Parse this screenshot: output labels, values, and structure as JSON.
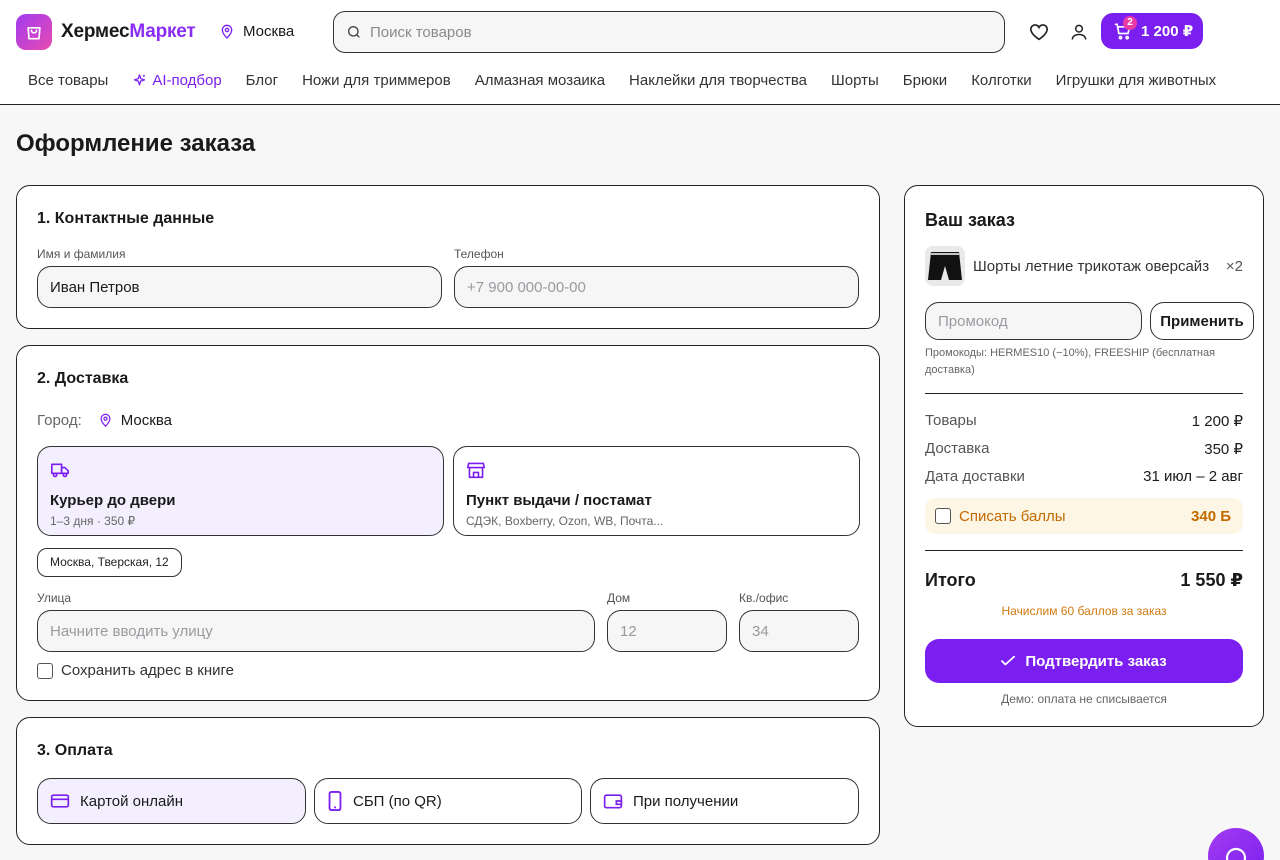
{
  "header": {
    "brand_part1": "Хермес",
    "brand_part2": "Маркет",
    "city": "Москва",
    "search_placeholder": "Поиск товаров",
    "cart_count": "2",
    "cart_total": "1 200 ₽"
  },
  "nav": {
    "items": [
      "Все товары",
      "AI-подбор",
      "Блог",
      "Ножи для триммеров",
      "Алмазная мозаика",
      "Наклейки для творчества",
      "Шорты",
      "Брюки",
      "Колготки",
      "Игрушки для животных"
    ]
  },
  "page": {
    "title": "Оформление заказа"
  },
  "contacts": {
    "title": "1. Контактные данные",
    "name_label": "Имя и фамилия",
    "name_value": "Иван Петров",
    "phone_label": "Телефон",
    "phone_placeholder": "+7 900 000-00-00"
  },
  "delivery": {
    "title": "2. Доставка",
    "city_label": "Город:",
    "city_value": "Москва",
    "courier_title": "Курьер до двери",
    "courier_sub": "1–3 дня · 350 ₽",
    "pickup_title": "Пункт выдачи / постамат",
    "pickup_sub": "СДЭК, Boxberry, Ozon, WB, Почта...",
    "saved_address": "Москва, Тверская, 12",
    "street_label": "Улица",
    "street_placeholder": "Начните вводить улицу",
    "house_label": "Дом",
    "house_placeholder": "12",
    "apt_label": "Кв./офис",
    "apt_placeholder": "34",
    "save_address_label": "Сохранить адрес в книге"
  },
  "payment": {
    "title": "3. Оплата",
    "options": [
      "Картой онлайн",
      "СБП (по QR)",
      "При получении"
    ],
    "selected": 0
  },
  "order": {
    "title": "Ваш заказ",
    "item_name": "Шорты летние трикотаж оверсайз",
    "item_qty": "×2",
    "promo_placeholder": "Промокод",
    "promo_button": "Применить",
    "promo_hint": "Промокоды: HERMES10 (−10%), FREESHIP (бесплатная доставка)",
    "goods_label": "Товары",
    "goods_value": "1 200 ₽",
    "delivery_label": "Доставка",
    "delivery_value": "350 ₽",
    "date_label": "Дата доставки",
    "date_value": "31 июл – 2 авг",
    "points_label": "Списать баллы",
    "points_value": "340 Б",
    "total_label": "Итого",
    "total_value": "1 550 ₽",
    "bonus_note": "Начислим 60 баллов за заказ",
    "confirm_label": "Подтвердить заказ",
    "demo_note": "Демо: оплата не списывается"
  },
  "colors": {
    "accent": "#7b1ff0",
    "brand_pink": "#e64bb0",
    "points_orange": "#c36a00"
  }
}
